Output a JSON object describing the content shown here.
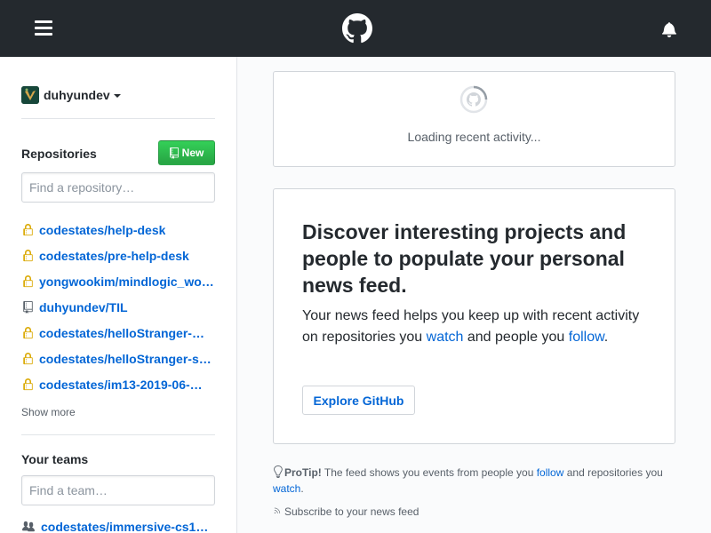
{
  "header": {
    "menu_icon": "hamburger-menu-icon",
    "logo_icon": "github-octocat-icon",
    "notification_icon": "bell-icon",
    "background_color": "#24292e"
  },
  "sidebar": {
    "account": {
      "username": "duhyundev",
      "avatar_icon": "avatar-image"
    },
    "repositories": {
      "title": "Repositories",
      "new_button_label": "New",
      "search_placeholder": "Find a repository…",
      "items": [
        {
          "name": "codestates/help-desk",
          "icon": "lock-icon",
          "private": true
        },
        {
          "name": "codestates/pre-help-desk",
          "icon": "lock-icon",
          "private": true
        },
        {
          "name": "yongwookim/mindlogic_wo…",
          "icon": "lock-icon",
          "private": true
        },
        {
          "name": "duhyundev/TIL",
          "icon": "repo-icon",
          "private": false
        },
        {
          "name": "codestates/helloStranger-…",
          "icon": "lock-icon",
          "private": true
        },
        {
          "name": "codestates/helloStranger-s…",
          "icon": "lock-icon",
          "private": true
        },
        {
          "name": "codestates/im13-2019-06-…",
          "icon": "lock-icon",
          "private": true
        }
      ],
      "show_more_label": "Show more"
    },
    "teams": {
      "title": "Your teams",
      "search_placeholder": "Find a team…",
      "items": [
        {
          "name": "codestates/immersive-cs1…",
          "icon": "team-icon"
        }
      ]
    }
  },
  "main": {
    "loading": {
      "text": "Loading recent activity..."
    },
    "discover": {
      "title": "Discover interesting projects and people to populate your personal news feed.",
      "text_before_watch": "Your news feed helps you keep up with recent activity on repositories you ",
      "watch_link": "watch",
      "text_between": " and people you ",
      "follow_link": "follow",
      "text_after": ".",
      "explore_button": "Explore GitHub"
    },
    "protip": {
      "label": "ProTip!",
      "text1": " The feed shows you events from people you ",
      "follow_link": "follow",
      "text2": " and repositories you ",
      "watch_link": "watch",
      "text3": "."
    },
    "subscribe_label": "Subscribe to your news feed"
  },
  "colors": {
    "link": "#0366d6",
    "private_lock": "#dbab09",
    "new_button": "#28a745"
  }
}
